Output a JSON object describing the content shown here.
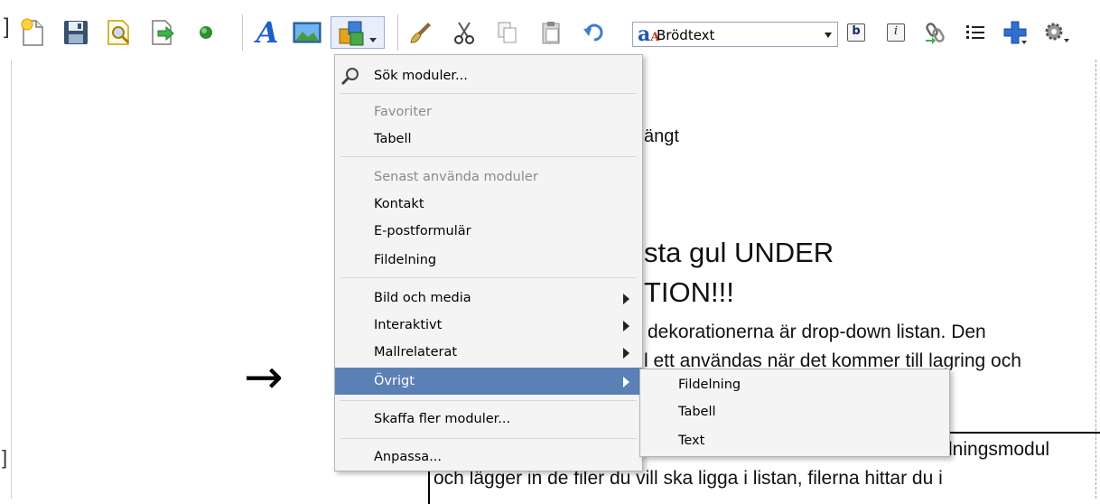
{
  "toolbar": {
    "buttons": [
      {
        "name": "new-page-icon"
      },
      {
        "name": "save-icon"
      },
      {
        "name": "preview-icon"
      },
      {
        "name": "publish-icon"
      },
      {
        "name": "status-dot-icon"
      },
      {
        "name": "text-style-icon"
      },
      {
        "name": "image-icon"
      },
      {
        "name": "modules-icon"
      },
      {
        "name": "brush-icon"
      },
      {
        "name": "cut-icon"
      },
      {
        "name": "copy-icon"
      },
      {
        "name": "paste-icon"
      },
      {
        "name": "undo-icon"
      },
      {
        "name": "bold-icon"
      },
      {
        "name": "italic-icon"
      },
      {
        "name": "link-icon"
      },
      {
        "name": "list-icon"
      },
      {
        "name": "add-icon"
      },
      {
        "name": "settings-icon"
      }
    ],
    "text_style_glyph": "A",
    "style_select_value": "Brödtext",
    "bold_label": "b",
    "italic_label": "i"
  },
  "content": {
    "line1": "ängt",
    "heading_line1": "sta gul UNDER",
    "heading_line2": "TION!!!",
    "para_line1": "dekorationerna är drop-down listan. Den",
    "para_line2": "l ett användas när det kommer till lagring och",
    "box_line1_a": "lningsmodul",
    "box_line2": "och lägger in de filer du vill ska ligga i listan, filerna hittar du i"
  },
  "menu": {
    "search": "Sök moduler...",
    "favorites_header": "Favoriter",
    "favorites": [
      "Tabell"
    ],
    "recent_header": "Senast använda moduler",
    "recent": [
      "Kontakt",
      "E-postformulär",
      "Fildelning"
    ],
    "categories": [
      "Bild och media",
      "Interaktivt",
      "Mallrelaterat",
      "Övrigt"
    ],
    "more": "Skaffa fler moduler...",
    "customize": "Anpassa..."
  },
  "submenu": {
    "items": [
      "Fildelning",
      "Tabell",
      "Text"
    ]
  },
  "colors": {
    "menu_highlight": "#5b80b6",
    "menu_bg": "#f4f4f4"
  }
}
